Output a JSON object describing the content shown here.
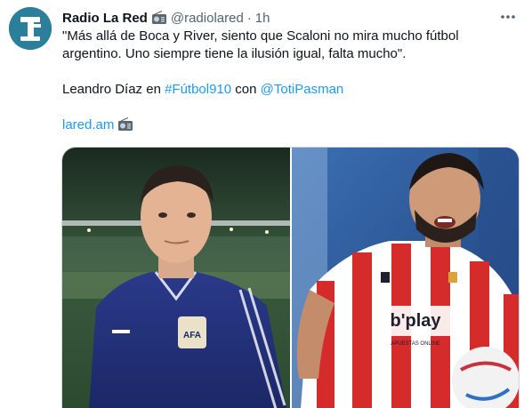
{
  "account": {
    "display_name": "Radio La Red",
    "handle": "@radiolared",
    "separator": "·",
    "time": "1h",
    "avatar_icon": "radio-la-red-logo-icon",
    "badge_icon": "radio-icon"
  },
  "tweet": {
    "line1": "\"Más allá de Boca y River, siento que Scaloni no mira mucho fútbol",
    "line2": "argentino. Uno siempre tiene la ilusión igual, falta mucho\".",
    "credit_prefix": "Leandro Díaz en ",
    "hashtag": "#Fútbol910",
    "credit_middle": " con ",
    "mention": "@TotiPasman",
    "link": "lared.am",
    "link_icon": "radio-icon"
  },
  "media": {
    "left_icon": "scaloni-photo",
    "right_icon": "player-photo",
    "sponsor_text": "b'play",
    "sponsor_sub": "APUESTAS ONLINE"
  },
  "more_icon": "more-options-icon",
  "colors": {
    "link": "#1d9bf0",
    "text": "#0f1419",
    "secondary": "#536471",
    "avatar_bg": "#2b7f9b"
  }
}
